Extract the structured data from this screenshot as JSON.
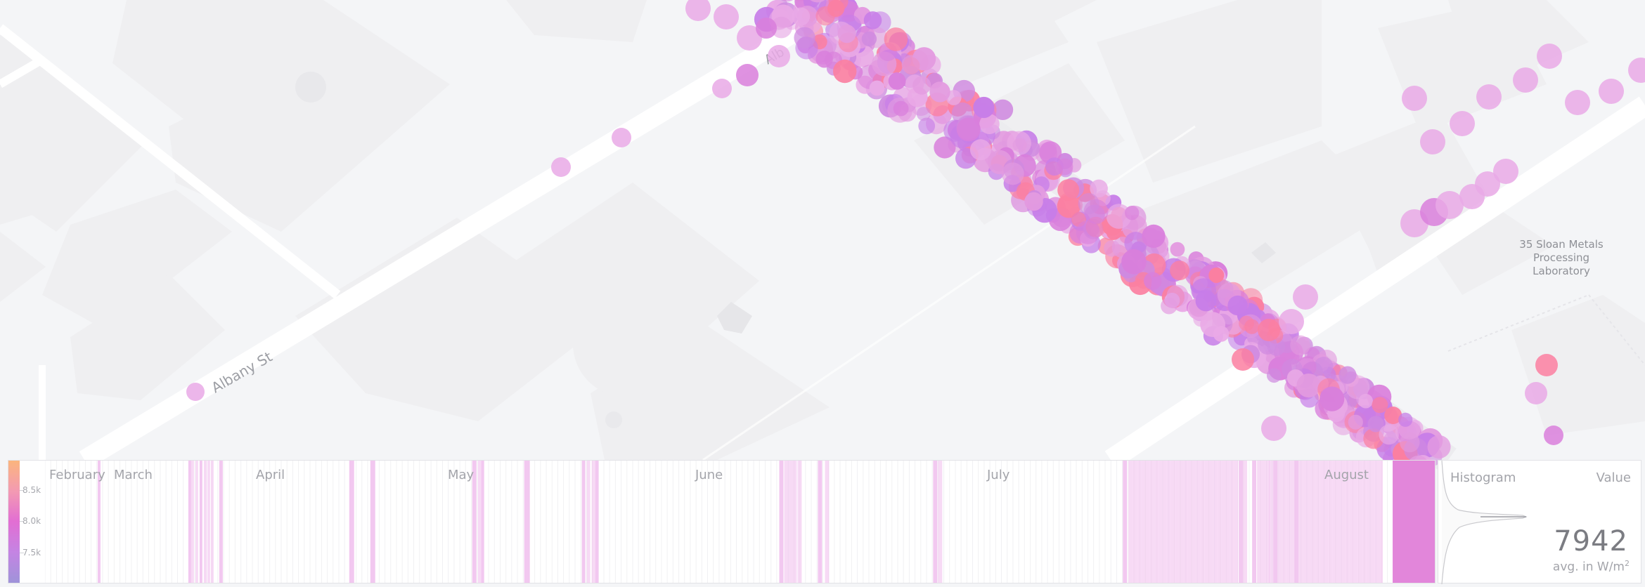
{
  "map": {
    "street_labels": [
      "Albany St",
      "Alb"
    ],
    "poi_label_lines": [
      "35 Sloan Metals",
      "Processing",
      "Laboratory"
    ],
    "colors": {
      "background": "#f4f5f7",
      "block": "#efeff1",
      "road": "#ffffff",
      "point_light": "#e9a9e6",
      "point_mid": "#d97fdc",
      "point_orange": "#fb7fa1"
    }
  },
  "timeline": {
    "legend_ticks": [
      "8.5k",
      "8.0k",
      "7.5k"
    ],
    "months": [
      "February",
      "March",
      "April",
      "May",
      "June",
      "July",
      "August"
    ],
    "colors": {
      "gradient": [
        "#fbb57d",
        "#f39ab2",
        "#e26ed3",
        "#c484e3",
        "#9f93d9"
      ],
      "highlight_band": "#f1c2ee",
      "selected_band": "#e07fd8"
    }
  },
  "histogram": {
    "title": "Histogram",
    "value_title": "Value",
    "value": "7942",
    "unit_text": "avg. in W/m",
    "unit_sup": "2"
  }
}
